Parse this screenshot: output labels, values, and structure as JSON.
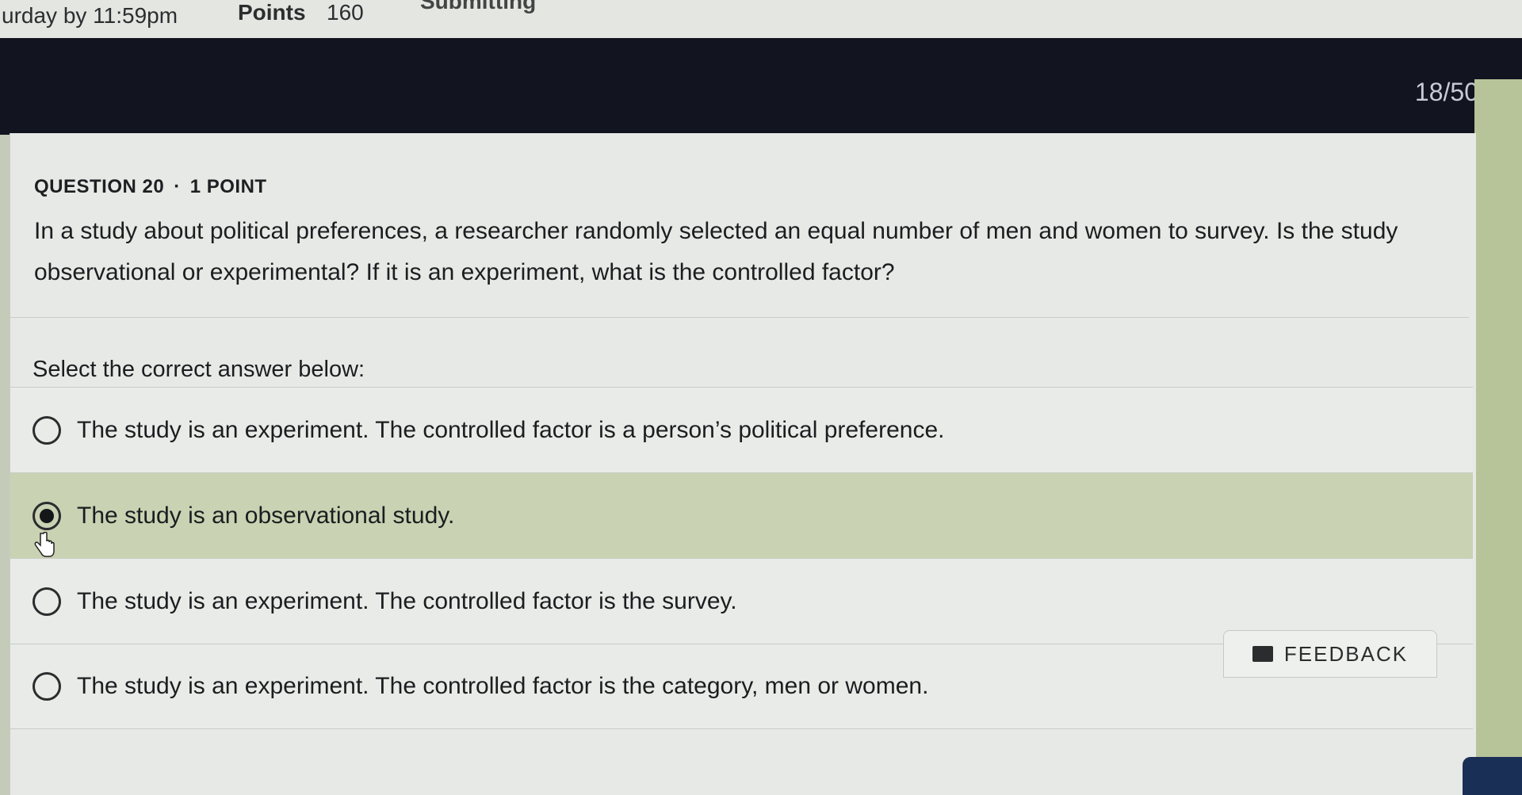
{
  "header": {
    "due_text": "urday by 11:59pm",
    "points_label": "Points",
    "points_value": "160",
    "submit_text": "Submitting"
  },
  "progress": {
    "count_text": "18/50"
  },
  "question": {
    "meta_number": "QUESTION 20",
    "meta_separator": "·",
    "meta_points": "1 POINT",
    "text": "In a study about political preferences, a researcher randomly selected an equal number of men and women to survey. Is the study observational or experimental? If it is an experiment, what is the controlled factor?",
    "prompt": "Select the correct answer below:",
    "options": [
      {
        "label": "The study is an experiment. The controlled factor is a person’s political preference.",
        "selected": false
      },
      {
        "label": "The study is an observational study.",
        "selected": true
      },
      {
        "label": "The study is an experiment. The controlled factor is the survey.",
        "selected": false
      },
      {
        "label": "The study is an experiment. The controlled factor is the category, men or women.",
        "selected": false
      }
    ]
  },
  "footer": {
    "feedback_label": "FEEDBACK"
  },
  "colors": {
    "dark_bar": "#12141f",
    "selected_option": "#c9d2b2",
    "card": "#e6e9e5",
    "accent_green": "#b7c49a"
  }
}
